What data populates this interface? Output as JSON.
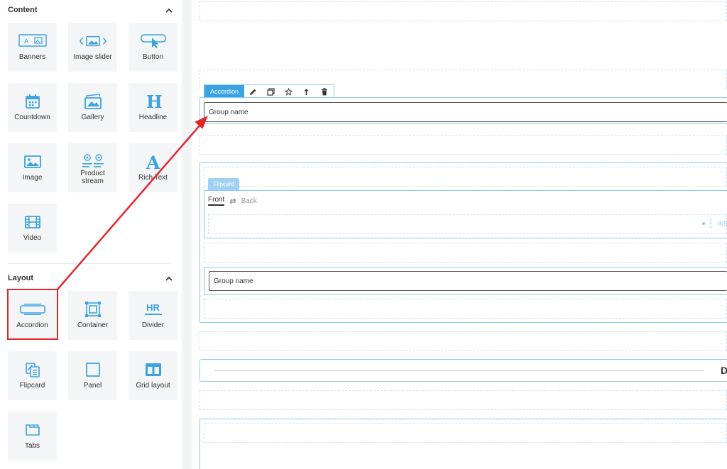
{
  "sidebar": {
    "content_section": {
      "title": "Content"
    },
    "content_tiles": [
      {
        "label": "Banners",
        "icon": "banners-icon"
      },
      {
        "label": "Image slider",
        "icon": "image-slider-icon"
      },
      {
        "label": "Button",
        "icon": "button-icon"
      },
      {
        "label": "Countdown",
        "icon": "calendar-icon"
      },
      {
        "label": "Gallery",
        "icon": "gallery-icon"
      },
      {
        "label": "Headline",
        "icon": "headline-icon"
      },
      {
        "label": "Image",
        "icon": "image-icon"
      },
      {
        "label": "Product stream",
        "label_line1": "Product",
        "label_line2": "stream",
        "icon": "product-stream-icon"
      },
      {
        "label": "Rich Text",
        "icon": "rich-text-icon"
      },
      {
        "label": "Video",
        "icon": "video-icon"
      }
    ],
    "layout_section": {
      "title": "Layout"
    },
    "layout_tiles": [
      {
        "label": "Accordion",
        "icon": "accordion-icon"
      },
      {
        "label": "Container",
        "icon": "container-icon"
      },
      {
        "label": "Divider",
        "icon": "divider-icon",
        "icon_text": "HR"
      },
      {
        "label": "Flipcard",
        "icon": "flipcard-icon"
      },
      {
        "label": "Panel",
        "icon": "panel-icon"
      },
      {
        "label": "Grid layout",
        "icon": "grid-layout-icon"
      },
      {
        "label": "Tabs",
        "icon": "tabs-icon"
      }
    ]
  },
  "canvas": {
    "accordion_toolbar": {
      "tag": "Accordion"
    },
    "accordion_group_name": "Group name",
    "flipcard": {
      "tag": "Flipcard",
      "front_tab": "Front",
      "swap_symbol": "⇄",
      "back_tab": "Back",
      "insert_label": "INS"
    },
    "inner_group_name": "Group name",
    "divider_letter": "D"
  },
  "colors": {
    "accent": "#3aa3e3",
    "icon_blue": "#3aa3e3",
    "highlight_red": "#e3262b",
    "tile_bg": "#f4f5f6"
  }
}
